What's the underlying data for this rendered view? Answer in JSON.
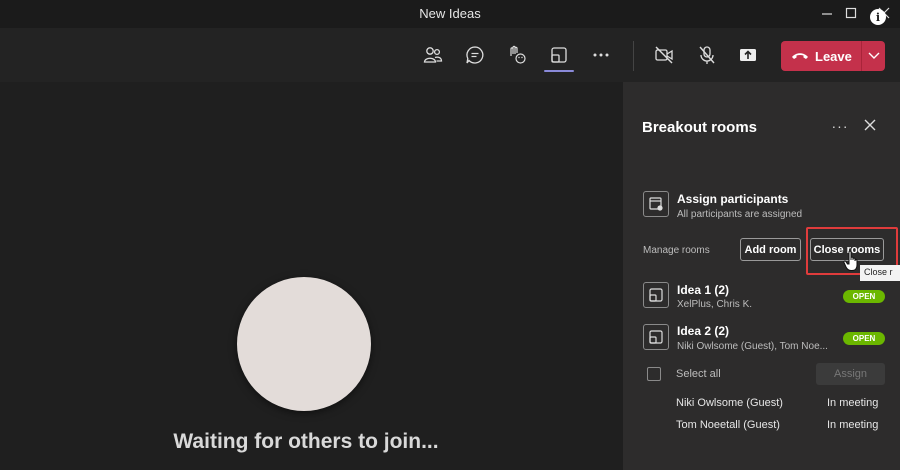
{
  "window": {
    "title": "New Ideas"
  },
  "toolbar": {
    "icons": [
      "people-icon",
      "chat-icon",
      "reactions-icon",
      "rooms-icon",
      "more-icon",
      "camera-off-icon",
      "mic-off-icon",
      "share-icon"
    ],
    "leave_label": "Leave",
    "leave_color": "#c4314b",
    "active_accent": "#8a8ad9"
  },
  "stage": {
    "waiting_text": "Waiting for others to join..."
  },
  "panel": {
    "title": "Breakout rooms",
    "assign": {
      "title": "Assign participants",
      "subtitle": "All participants are assigned"
    },
    "manage_label": "Manage rooms",
    "add_room_label": "Add room",
    "close_rooms_label": "Close rooms",
    "tooltip": "Close r",
    "rooms": [
      {
        "name": "Idea 1 (2)",
        "people": "XelPlus, Chris K.",
        "status": "OPEN"
      },
      {
        "name": "Idea 2 (2)",
        "people": "Niki Owlsome (Guest), Tom Noe...",
        "status": "OPEN"
      }
    ],
    "select_all_label": "Select all",
    "assign_button": "Assign",
    "participants": [
      {
        "name": "Niki Owlsome (Guest)",
        "status": "In meeting"
      },
      {
        "name": "Tom Noeetall (Guest)",
        "status": "In meeting"
      }
    ],
    "open_color": "#6bb700"
  }
}
